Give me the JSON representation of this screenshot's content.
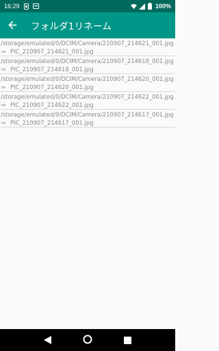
{
  "status_bar": {
    "time": "16:29",
    "battery": "100%",
    "icons": [
      "sim-card-icon",
      "notification-app-icon",
      "wifi-icon",
      "signal-icon",
      "battery-icon"
    ]
  },
  "app_bar": {
    "title": "フォルダ1リネーム",
    "back_icon": "arrow-back-icon"
  },
  "rename_items": [
    {
      "source": "/storage/emulated/0/DCIM/Camera/210907_214621_001.jpg",
      "arrow": "⇒",
      "target": "PIC_210907_214621_001.jpg"
    },
    {
      "source": "/storage/emulated/0/DCIM/Camera/210907_214618_001.jpg",
      "arrow": "⇒",
      "target": "PIC_210907_214618_001.jpg"
    },
    {
      "source": "/storage/emulated/0/DCIM/Camera/210907_214620_001.jpg",
      "arrow": "⇒",
      "target": "PIC_210907_214620_001.jpg"
    },
    {
      "source": "/storage/emulated/0/DCIM/Camera/210907_214622_001.jpg",
      "arrow": "⇒",
      "target": "PIC_210907_214622_001.jpg"
    },
    {
      "source": "/storage/emulated/0/DCIM/Camera/210907_214617_001.jpg",
      "arrow": "⇒",
      "target": "PIC_210907_214617_001.jpg"
    }
  ],
  "nav_bar": {
    "buttons": [
      "back-triangle-icon",
      "home-circle-icon",
      "recents-square-icon"
    ]
  },
  "colors": {
    "status_bar": "#00695c",
    "app_bar": "#009688",
    "text_secondary": "#8a8a8a"
  }
}
